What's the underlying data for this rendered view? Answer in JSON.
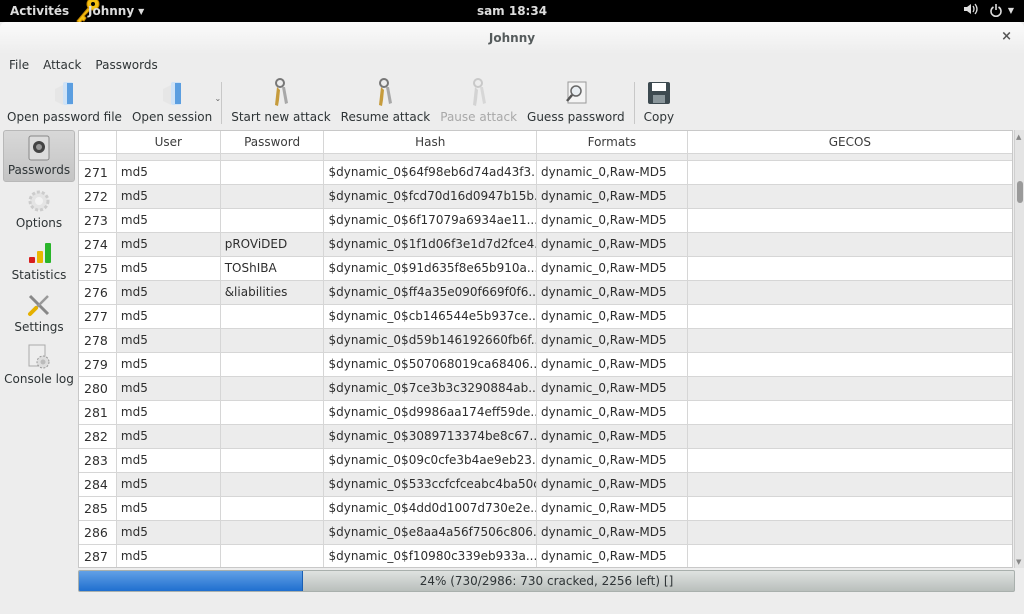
{
  "topbar": {
    "activities": "Activités",
    "app_menu": "Johnny",
    "clock": "sam 18:34"
  },
  "window": {
    "title": "Johnny",
    "close_label": "×"
  },
  "menu": [
    "File",
    "Attack",
    "Passwords"
  ],
  "toolbar": {
    "open_password_file": "Open password file",
    "open_session": "Open session",
    "start_new_attack": "Start new attack",
    "resume_attack": "Resume attack",
    "pause_attack": "Pause attack",
    "guess_password": "Guess password",
    "copy": "Copy"
  },
  "sidebar": {
    "items": [
      {
        "label": "Passwords",
        "active": true
      },
      {
        "label": "Options",
        "active": false
      },
      {
        "label": "Statistics",
        "active": false
      },
      {
        "label": "Settings",
        "active": false
      },
      {
        "label": "Console log",
        "active": false
      }
    ]
  },
  "table": {
    "columns": [
      "",
      "User",
      "Password",
      "Hash",
      "Formats",
      "GECOS"
    ],
    "rows": [
      {
        "n": "271",
        "user": "md5",
        "password": "",
        "hash": "$dynamic_0$64f98eb6d74ad43f3...",
        "formats": "dynamic_0,Raw-MD5",
        "gecos": ""
      },
      {
        "n": "272",
        "user": "md5",
        "password": "",
        "hash": "$dynamic_0$fcd70d16d0947b15b...",
        "formats": "dynamic_0,Raw-MD5",
        "gecos": ""
      },
      {
        "n": "273",
        "user": "md5",
        "password": "",
        "hash": "$dynamic_0$6f17079a6934ae11...",
        "formats": "dynamic_0,Raw-MD5",
        "gecos": ""
      },
      {
        "n": "274",
        "user": "md5",
        "password": "pROViDED",
        "hash": "$dynamic_0$1f1d06f3e1d7d2fce4...",
        "formats": "dynamic_0,Raw-MD5",
        "gecos": ""
      },
      {
        "n": "275",
        "user": "md5",
        "password": "TOShIBA",
        "hash": "$dynamic_0$91d635f8e65b910a...",
        "formats": "dynamic_0,Raw-MD5",
        "gecos": ""
      },
      {
        "n": "276",
        "user": "md5",
        "password": "&liabilities",
        "hash": "$dynamic_0$ff4a35e090f669f0f6...",
        "formats": "dynamic_0,Raw-MD5",
        "gecos": ""
      },
      {
        "n": "277",
        "user": "md5",
        "password": "",
        "hash": "$dynamic_0$cb146544e5b937ce...",
        "formats": "dynamic_0,Raw-MD5",
        "gecos": ""
      },
      {
        "n": "278",
        "user": "md5",
        "password": "",
        "hash": "$dynamic_0$d59b146192660fb6f...",
        "formats": "dynamic_0,Raw-MD5",
        "gecos": ""
      },
      {
        "n": "279",
        "user": "md5",
        "password": "",
        "hash": "$dynamic_0$507068019ca68406...",
        "formats": "dynamic_0,Raw-MD5",
        "gecos": ""
      },
      {
        "n": "280",
        "user": "md5",
        "password": "",
        "hash": "$dynamic_0$7ce3b3c3290884ab...",
        "formats": "dynamic_0,Raw-MD5",
        "gecos": ""
      },
      {
        "n": "281",
        "user": "md5",
        "password": "",
        "hash": "$dynamic_0$d9986aa174eff59de...",
        "formats": "dynamic_0,Raw-MD5",
        "gecos": ""
      },
      {
        "n": "282",
        "user": "md5",
        "password": "",
        "hash": "$dynamic_0$3089713374be8c67...",
        "formats": "dynamic_0,Raw-MD5",
        "gecos": ""
      },
      {
        "n": "283",
        "user": "md5",
        "password": "",
        "hash": "$dynamic_0$09c0cfe3b4ae9eb23...",
        "formats": "dynamic_0,Raw-MD5",
        "gecos": ""
      },
      {
        "n": "284",
        "user": "md5",
        "password": "",
        "hash": "$dynamic_0$533ccfcfceabc4ba50c...",
        "formats": "dynamic_0,Raw-MD5",
        "gecos": ""
      },
      {
        "n": "285",
        "user": "md5",
        "password": "",
        "hash": "$dynamic_0$4dd0d1007d730e2e...",
        "formats": "dynamic_0,Raw-MD5",
        "gecos": ""
      },
      {
        "n": "286",
        "user": "md5",
        "password": "",
        "hash": "$dynamic_0$e8aa4a56f7506c806...",
        "formats": "dynamic_0,Raw-MD5",
        "gecos": ""
      },
      {
        "n": "287",
        "user": "md5",
        "password": "",
        "hash": "$dynamic_0$f10980c339eb933a...",
        "formats": "dynamic_0,Raw-MD5",
        "gecos": ""
      }
    ]
  },
  "progress": {
    "percent": 24,
    "text": "24% (730/2986: 730 cracked, 2256 left) []"
  }
}
